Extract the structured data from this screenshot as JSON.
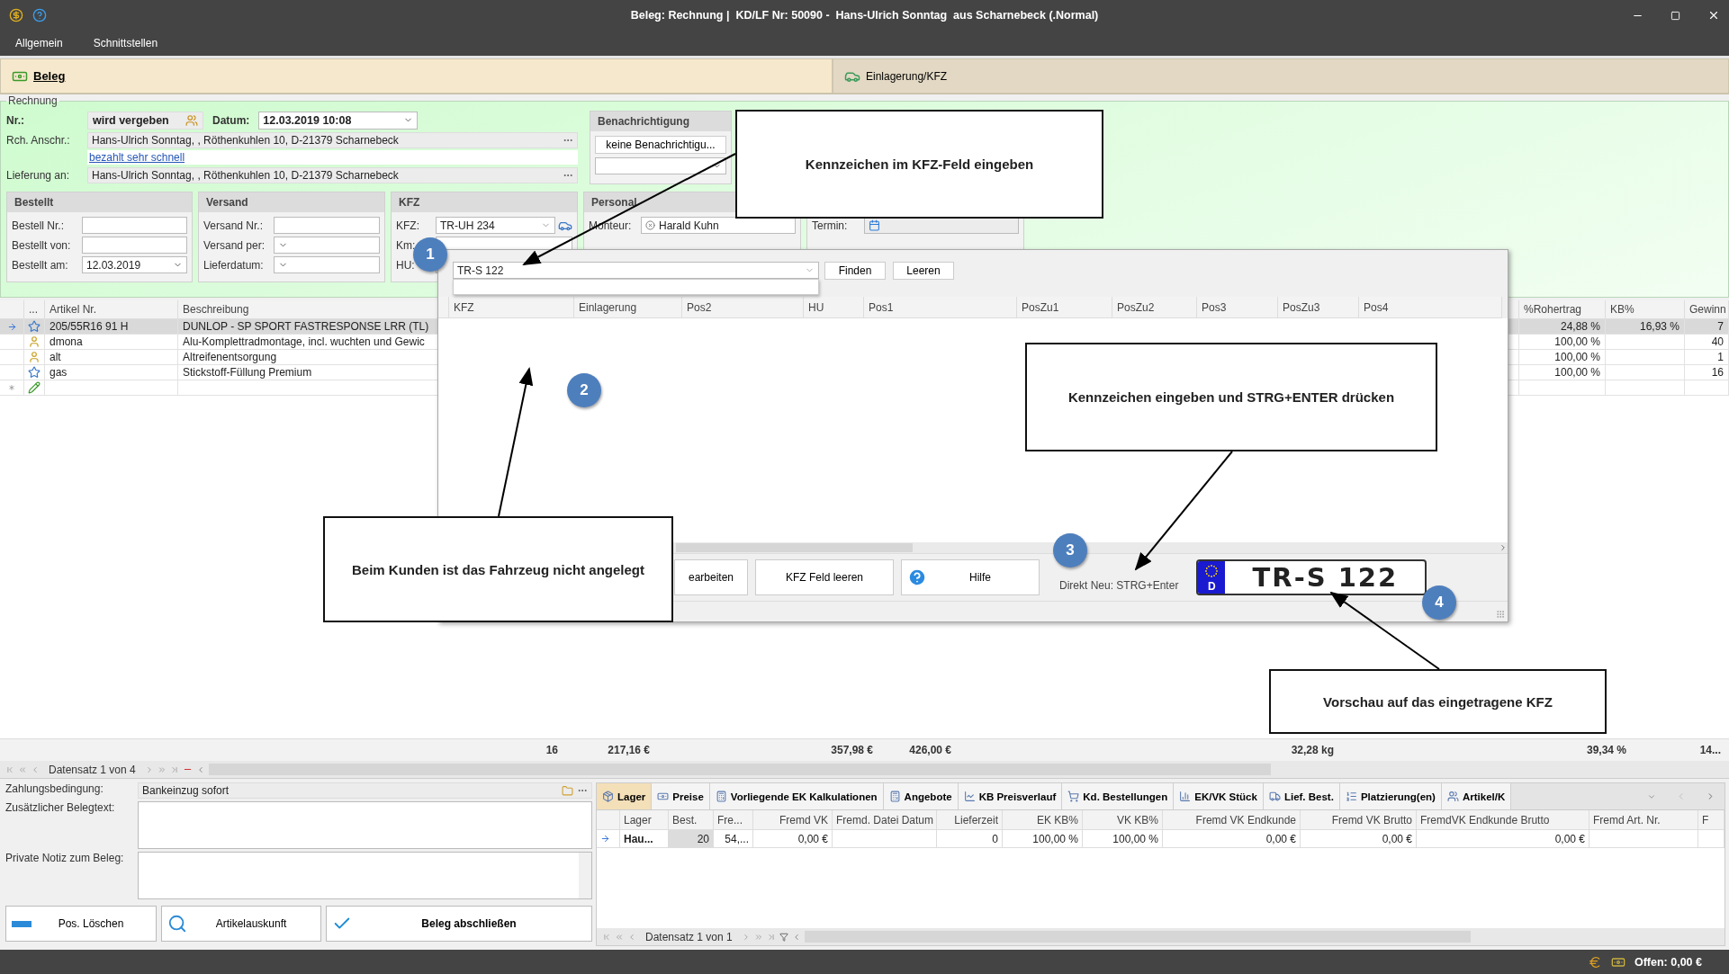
{
  "window": {
    "title": "Beleg: Rechnung |  KD/LF Nr: 50090 -  Hans-Ulrich Sonntag  aus Scharnebeck (.Normal)"
  },
  "menu": [
    "Allgemein",
    "Schnittstellen"
  ],
  "tabs": [
    {
      "label": "Beleg",
      "selected": true
    },
    {
      "label": "Einlagerung/KFZ",
      "selected": false
    }
  ],
  "header": {
    "legend": "Rechnung",
    "nr_label": "Nr.:",
    "nr_value": "wird vergeben",
    "datum_label": "Datum:",
    "datum_value": "12.03.2019 10:08",
    "rch_label": "Rch. Anschr.:",
    "rch_value": "Hans-Ulrich Sonntag, , Röthenkuhlen 10, D-21379 Scharnebeck",
    "link": "bezahlt sehr schnell",
    "lieferung_label": "Lieferung an:",
    "lieferung_value": "Hans-Ulrich Sonntag, , Röthenkuhlen 10, D-21379 Scharnebeck"
  },
  "benachrichtigung": {
    "title": "Benachrichtigung",
    "button": "keine Benachrichtigu..."
  },
  "groups": [
    {
      "title": "Bestellt",
      "fields": [
        {
          "label": "Bestell Nr.:",
          "kind": "text"
        },
        {
          "label": "Bestellt von:",
          "kind": "text"
        },
        {
          "label": "Bestellt am:",
          "kind": "combo",
          "value": "12.03.2019"
        }
      ]
    },
    {
      "title": "Versand",
      "fields": [
        {
          "label": "Versand Nr.:",
          "kind": "text"
        },
        {
          "label": "Versand per:",
          "kind": "combo"
        },
        {
          "label": "Lieferdatum:",
          "kind": "combo"
        }
      ]
    },
    {
      "title": "KFZ",
      "fields": [
        {
          "label": "KFZ:",
          "kind": "vehicle",
          "value": "TR-UH 234"
        },
        {
          "label": "Km:",
          "kind": "text"
        },
        {
          "label": "HU:",
          "kind": "text"
        }
      ]
    },
    {
      "title": "Personal",
      "fields": [
        {
          "label": "Monteur:",
          "kind": "person",
          "value": "Harald Kuhn"
        }
      ]
    },
    {
      "fields": [
        {
          "label": "Termin:",
          "kind": "calendar"
        }
      ]
    }
  ],
  "grid": {
    "columns": [
      "...",
      "Artikel Nr.",
      "Beschreibung",
      "%Rohertrag",
      "KB%",
      "Gewinn"
    ],
    "rows": [
      {
        "kind": "article",
        "selected": true,
        "artikel": "205/55R16 91 H",
        "beschreibung": "DUNLOP - SP SPORT FASTRESPONSE LRR (TL)",
        "rohertrag": "24,88 %",
        "kb": "16,93 %",
        "gewinn": "7"
      },
      {
        "kind": "service",
        "selected": false,
        "artikel": "dmona",
        "beschreibung": "Alu-Komplettradmontage, incl. wuchten und Gewic",
        "rohertrag": "100,00 %",
        "gewinn": "40"
      },
      {
        "kind": "service",
        "selected": false,
        "artikel": "alt",
        "beschreibung": "Altreifenentsorgung",
        "rohertrag": "100,00 %",
        "gewinn": "1"
      },
      {
        "kind": "article",
        "selected": false,
        "artikel": "gas",
        "beschreibung": "Stickstoff-Füllung Premium",
        "rohertrag": "100,00 %",
        "gewinn": "16"
      },
      {
        "kind": "new",
        "selected": false
      }
    ]
  },
  "summary": [
    "16",
    "217,16 €",
    "357,98 €",
    "426,00 €",
    "32,28 kg",
    "39,34 %",
    "14..."
  ],
  "nav": "Datensatz 1 von 4",
  "popup": {
    "search_value": "TR-S 122",
    "buttons": [
      "Finden",
      "Leeren"
    ],
    "columns": [
      "KFZ",
      "Einlagerung",
      "Pos2",
      "HU",
      "Pos1",
      "PosZu1",
      "PosZu2",
      "Pos3",
      "PosZu3",
      "Pos4"
    ],
    "actions": [
      {
        "label": "earbeiten",
        "kind": "plain"
      },
      {
        "label": "KFZ Feld leeren",
        "kind": "plain"
      },
      {
        "label": "Hilfe",
        "kind": "help"
      }
    ],
    "hint": "Direkt Neu: STRG+Enter",
    "plate": {
      "country": "D",
      "text": "TR-S 122"
    }
  },
  "markers": [
    "1",
    "2",
    "3",
    "4"
  ],
  "callouts": [
    "Kennzeichen im KFZ-Feld eingeben",
    "Kennzeichen eingeben und STRG+ENTER drücken",
    "Beim Kunden ist das Fahrzeug nicht angelegt",
    "Vorschau auf das eingetragene KFZ"
  ],
  "bottom": {
    "payment_label": "Zahlungsbedingung:",
    "payment_value": "Bankeinzug sofort",
    "belegtext_label": "Zusätzlicher Belegtext:",
    "notiz_label": "Private Notiz zum Beleg:",
    "actions": [
      {
        "label": "Pos. Löschen",
        "kind": "delete"
      },
      {
        "label": "Artikelauskunft",
        "kind": "info"
      },
      {
        "label": "Beleg abschließen",
        "kind": "finish"
      }
    ]
  },
  "detail": {
    "tabs": [
      {
        "label": "Lager",
        "selected": true
      },
      {
        "label": "Preise",
        "selected": false
      },
      {
        "label": "Vorliegende EK Kalkulationen",
        "selected": false
      },
      {
        "label": "Angebote",
        "selected": false
      },
      {
        "label": "KB Preisverlauf",
        "selected": false
      },
      {
        "label": "Kd. Bestellungen",
        "selected": false
      },
      {
        "label": "EK/VK Stück",
        "selected": false
      },
      {
        "label": "Lief. Best.",
        "selected": false
      },
      {
        "label": "Platzierung(en)",
        "selected": false
      },
      {
        "label": "Artikel/K",
        "selected": false
      }
    ],
    "columns": [
      "Lager",
      "Best.",
      "Fre...",
      "Fremd VK",
      "Fremd. Datei Datum",
      "Lieferzeit",
      "EK KB%",
      "VK KB%",
      "Fremd VK Endkunde",
      "Fremd VK Brutto",
      "FremdVK Endkunde Brutto",
      "Fremd Art. Nr.",
      "F"
    ],
    "rows": [
      {
        "selected": true,
        "cells": [
          "Hau...",
          "20",
          "54,...",
          "0,00 €",
          null,
          "0",
          "100,00 %",
          "100,00 %",
          "0,00 €",
          "0,00 €",
          "0,00 €",
          null,
          null
        ]
      }
    ],
    "nav": "Datensatz 1 von 1"
  },
  "status": {
    "offen": "Offen: 0,00 €"
  }
}
